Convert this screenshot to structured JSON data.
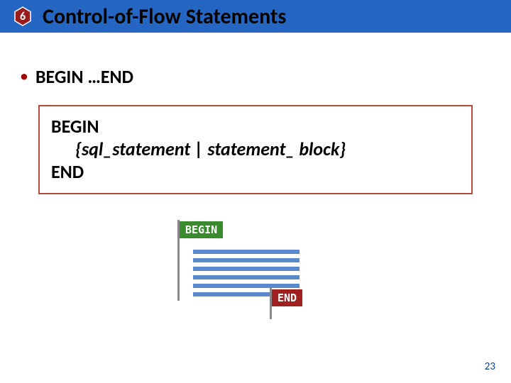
{
  "header": {
    "badge_number": "6",
    "title": "Control-of-Flow Statements"
  },
  "bullet": {
    "text": "BEGIN …END"
  },
  "syntax": {
    "line1": "BEGIN",
    "line2": "{sql_statement | statement_ block}",
    "line3": "END"
  },
  "diagram": {
    "begin_label": "BEGIN",
    "end_label": "END"
  },
  "page_number": "23"
}
